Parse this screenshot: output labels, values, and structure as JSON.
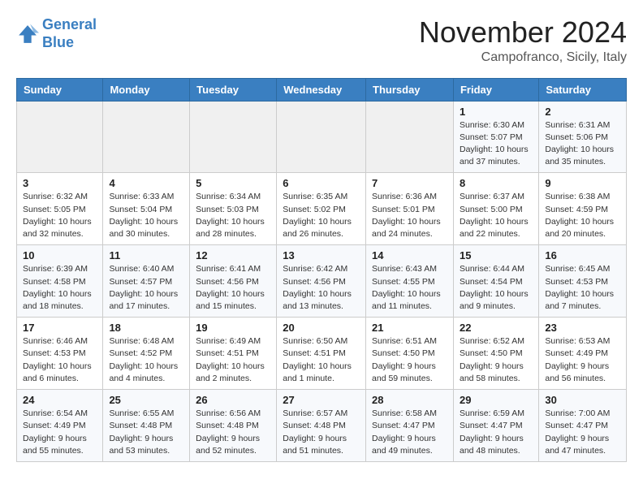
{
  "header": {
    "logo_line1": "General",
    "logo_line2": "Blue",
    "month_title": "November 2024",
    "location": "Campofranco, Sicily, Italy"
  },
  "days_of_week": [
    "Sunday",
    "Monday",
    "Tuesday",
    "Wednesday",
    "Thursday",
    "Friday",
    "Saturday"
  ],
  "weeks": [
    [
      {
        "day": "",
        "info": ""
      },
      {
        "day": "",
        "info": ""
      },
      {
        "day": "",
        "info": ""
      },
      {
        "day": "",
        "info": ""
      },
      {
        "day": "",
        "info": ""
      },
      {
        "day": "1",
        "info": "Sunrise: 6:30 AM\nSunset: 5:07 PM\nDaylight: 10 hours\nand 37 minutes."
      },
      {
        "day": "2",
        "info": "Sunrise: 6:31 AM\nSunset: 5:06 PM\nDaylight: 10 hours\nand 35 minutes."
      }
    ],
    [
      {
        "day": "3",
        "info": "Sunrise: 6:32 AM\nSunset: 5:05 PM\nDaylight: 10 hours\nand 32 minutes."
      },
      {
        "day": "4",
        "info": "Sunrise: 6:33 AM\nSunset: 5:04 PM\nDaylight: 10 hours\nand 30 minutes."
      },
      {
        "day": "5",
        "info": "Sunrise: 6:34 AM\nSunset: 5:03 PM\nDaylight: 10 hours\nand 28 minutes."
      },
      {
        "day": "6",
        "info": "Sunrise: 6:35 AM\nSunset: 5:02 PM\nDaylight: 10 hours\nand 26 minutes."
      },
      {
        "day": "7",
        "info": "Sunrise: 6:36 AM\nSunset: 5:01 PM\nDaylight: 10 hours\nand 24 minutes."
      },
      {
        "day": "8",
        "info": "Sunrise: 6:37 AM\nSunset: 5:00 PM\nDaylight: 10 hours\nand 22 minutes."
      },
      {
        "day": "9",
        "info": "Sunrise: 6:38 AM\nSunset: 4:59 PM\nDaylight: 10 hours\nand 20 minutes."
      }
    ],
    [
      {
        "day": "10",
        "info": "Sunrise: 6:39 AM\nSunset: 4:58 PM\nDaylight: 10 hours\nand 18 minutes."
      },
      {
        "day": "11",
        "info": "Sunrise: 6:40 AM\nSunset: 4:57 PM\nDaylight: 10 hours\nand 17 minutes."
      },
      {
        "day": "12",
        "info": "Sunrise: 6:41 AM\nSunset: 4:56 PM\nDaylight: 10 hours\nand 15 minutes."
      },
      {
        "day": "13",
        "info": "Sunrise: 6:42 AM\nSunset: 4:56 PM\nDaylight: 10 hours\nand 13 minutes."
      },
      {
        "day": "14",
        "info": "Sunrise: 6:43 AM\nSunset: 4:55 PM\nDaylight: 10 hours\nand 11 minutes."
      },
      {
        "day": "15",
        "info": "Sunrise: 6:44 AM\nSunset: 4:54 PM\nDaylight: 10 hours\nand 9 minutes."
      },
      {
        "day": "16",
        "info": "Sunrise: 6:45 AM\nSunset: 4:53 PM\nDaylight: 10 hours\nand 7 minutes."
      }
    ],
    [
      {
        "day": "17",
        "info": "Sunrise: 6:46 AM\nSunset: 4:53 PM\nDaylight: 10 hours\nand 6 minutes."
      },
      {
        "day": "18",
        "info": "Sunrise: 6:48 AM\nSunset: 4:52 PM\nDaylight: 10 hours\nand 4 minutes."
      },
      {
        "day": "19",
        "info": "Sunrise: 6:49 AM\nSunset: 4:51 PM\nDaylight: 10 hours\nand 2 minutes."
      },
      {
        "day": "20",
        "info": "Sunrise: 6:50 AM\nSunset: 4:51 PM\nDaylight: 10 hours\nand 1 minute."
      },
      {
        "day": "21",
        "info": "Sunrise: 6:51 AM\nSunset: 4:50 PM\nDaylight: 9 hours\nand 59 minutes."
      },
      {
        "day": "22",
        "info": "Sunrise: 6:52 AM\nSunset: 4:50 PM\nDaylight: 9 hours\nand 58 minutes."
      },
      {
        "day": "23",
        "info": "Sunrise: 6:53 AM\nSunset: 4:49 PM\nDaylight: 9 hours\nand 56 minutes."
      }
    ],
    [
      {
        "day": "24",
        "info": "Sunrise: 6:54 AM\nSunset: 4:49 PM\nDaylight: 9 hours\nand 55 minutes."
      },
      {
        "day": "25",
        "info": "Sunrise: 6:55 AM\nSunset: 4:48 PM\nDaylight: 9 hours\nand 53 minutes."
      },
      {
        "day": "26",
        "info": "Sunrise: 6:56 AM\nSunset: 4:48 PM\nDaylight: 9 hours\nand 52 minutes."
      },
      {
        "day": "27",
        "info": "Sunrise: 6:57 AM\nSunset: 4:48 PM\nDaylight: 9 hours\nand 51 minutes."
      },
      {
        "day": "28",
        "info": "Sunrise: 6:58 AM\nSunset: 4:47 PM\nDaylight: 9 hours\nand 49 minutes."
      },
      {
        "day": "29",
        "info": "Sunrise: 6:59 AM\nSunset: 4:47 PM\nDaylight: 9 hours\nand 48 minutes."
      },
      {
        "day": "30",
        "info": "Sunrise: 7:00 AM\nSunset: 4:47 PM\nDaylight: 9 hours\nand 47 minutes."
      }
    ]
  ]
}
